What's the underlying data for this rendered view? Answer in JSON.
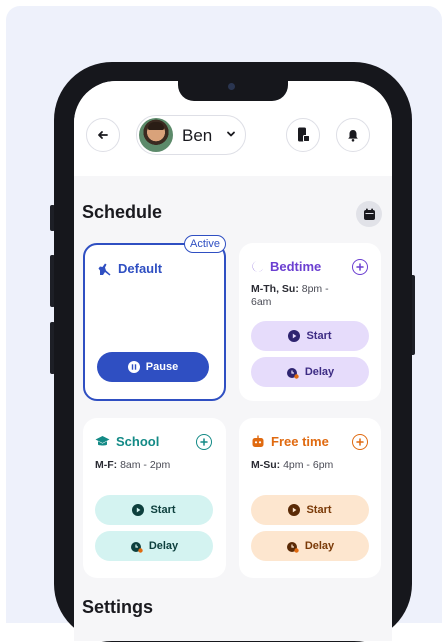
{
  "profile": {
    "name": "Ben"
  },
  "schedule": {
    "title": "Schedule",
    "cards": {
      "default": {
        "title": "Default",
        "badge": "Active",
        "action": "Pause"
      },
      "bedtime": {
        "title": "Bedtime",
        "days": "M-Th, Su:",
        "time": "8pm -",
        "time2": "6am",
        "start": "Start",
        "delay": "Delay"
      },
      "school": {
        "title": "School",
        "days": "M-F:",
        "time": "8am - 2pm",
        "start": "Start",
        "delay": "Delay"
      },
      "freetime": {
        "title": "Free time",
        "days": "M-Su:",
        "time": "4pm - 6pm",
        "start": "Start",
        "delay": "Delay"
      }
    }
  },
  "settings": {
    "title": "Settings"
  },
  "colors": {
    "accent_blue": "#2f4fc2",
    "bedtime": "#6b3fd1",
    "bedtime_soft": "#e6dcfb",
    "school": "#138a86",
    "school_soft": "#d4f3f1",
    "freetime": "#e06a10",
    "freetime_soft": "#fde6cf"
  }
}
